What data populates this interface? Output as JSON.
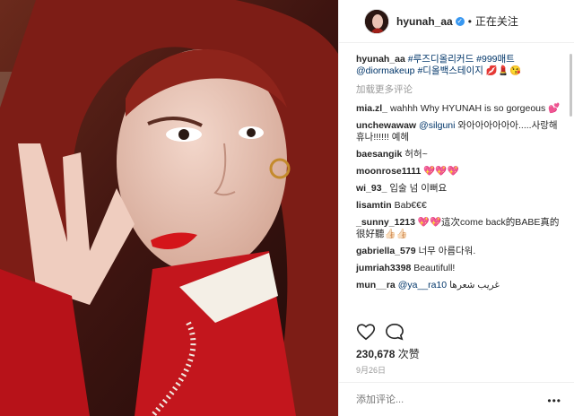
{
  "header": {
    "username": "hyunah_aa",
    "separator": "•",
    "follow_state": "正在关注"
  },
  "caption": {
    "username": "hyunah_aa",
    "text_part1": "#루즈디올리커드 #999매트",
    "text_part2": "@diormakeup #디올백스테이지",
    "emoji": "💋💄😘"
  },
  "load_more": "加载更多评论",
  "comments": [
    {
      "user": "mia.zl_",
      "text": "wahhh Why HYUNAH is so gorgeous 💕"
    },
    {
      "user": "unchewawaw",
      "mention": "@silguni",
      "text": "와아아아아아아.....사랑해휴나!!!!!! 예헤"
    },
    {
      "user": "baesangik",
      "text": "허허~"
    },
    {
      "user": "moonrose1111",
      "text": "💖💖💖"
    },
    {
      "user": "wi_93_",
      "text": "입술 넘 이뻐요"
    },
    {
      "user": "lisamtin",
      "text": "Bab€€€"
    },
    {
      "user": "_sunny_1213",
      "text": "💖💖這次come back的BABE真的很好聽👍🏻👍🏻"
    },
    {
      "user": "gabriella_579",
      "text": "너무 아름다워."
    },
    {
      "user": "jumriah3398",
      "text": "Beautifull!"
    },
    {
      "user": "mun__ra",
      "mention": "@ya__ra10",
      "text": "غريب شعرها"
    }
  ],
  "likes": {
    "count": "230,678",
    "unit": "次赞"
  },
  "date": "9月26日",
  "add_comment": {
    "placeholder": "添加评论..."
  },
  "more_glyph": "•••",
  "icons": {
    "like": "heart-icon",
    "comment": "comment-icon",
    "options": "more-options-icon"
  },
  "colors": {
    "verified": "#3897f0",
    "link": "#003569",
    "muted": "#999999"
  }
}
